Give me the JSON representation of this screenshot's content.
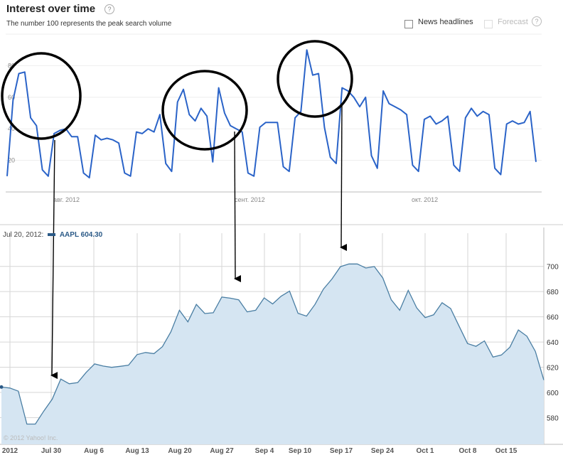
{
  "header": {
    "title": "Interest over time",
    "subtitle": "The number 100 represents the peak search volume",
    "help_label": "?",
    "news_label": "News headlines",
    "forecast_label": "Forecast"
  },
  "stock_tooltip": {
    "date": "Jul 20, 2012:",
    "symbol_value": "AAPL 604.30"
  },
  "copyright": "© 2012 Yahoo! Inc.",
  "colors": {
    "trend_line": "#2a63c8",
    "stock_line": "#4a7ea3",
    "stock_fill": "#d5e5f2",
    "annotation": "#000000"
  },
  "chart_data": [
    {
      "type": "line",
      "title": "Interest over time",
      "ylim": [
        0,
        100
      ],
      "y_ticks": [
        20,
        40,
        60,
        80
      ],
      "x_tick_labels": [
        "авг. 2012",
        "сент. 2012",
        "окт. 2012"
      ],
      "grid": true,
      "series": [
        {
          "values": [
            10,
            58,
            75,
            76,
            47,
            42,
            14,
            10,
            37,
            39,
            40,
            35,
            35,
            12,
            9,
            36,
            33,
            34,
            33,
            31,
            12,
            10,
            38,
            37,
            40,
            38,
            49,
            18,
            13,
            57,
            65,
            49,
            45,
            53,
            48,
            19,
            66,
            50,
            42,
            40,
            38,
            12,
            10,
            41,
            44,
            44,
            44,
            16,
            13,
            47,
            51,
            90,
            74,
            75,
            41,
            22,
            18,
            66,
            64,
            60,
            54,
            60,
            23,
            15,
            64,
            56,
            54,
            52,
            49,
            17,
            13,
            46,
            48,
            43,
            45,
            48,
            17,
            13,
            47,
            53,
            48,
            51,
            49,
            15,
            11,
            43,
            45,
            43,
            44,
            51,
            19
          ]
        }
      ]
    },
    {
      "type": "area",
      "ylim": [
        570,
        710
      ],
      "y_ticks": [
        580,
        600,
        620,
        640,
        660,
        680,
        700
      ],
      "x_tick_labels": [
        "2012",
        "Jul 30",
        "Aug 6",
        "Aug 13",
        "Aug 20",
        "Aug 27",
        "Sep 4",
        "Sep 10",
        "Sep 17",
        "Sep 24",
        "Oct 1",
        "Oct 8",
        "Oct 15"
      ],
      "grid": true,
      "series": [
        {
          "name": "AAPL",
          "values": [
            604.3,
            603.5,
            601,
            574.9,
            574.9,
            585.2,
            594.7,
            610.6,
            606.9,
            607.8,
            615.9,
            622.6,
            620.9,
            619.9,
            620.7,
            621.6,
            630,
            631.7,
            630.8,
            636.3,
            648.1,
            665.2,
            656,
            669.8,
            662.6,
            663.2,
            675.7,
            674.8,
            673.5,
            663.9,
            665.2,
            675,
            670.2,
            676.3,
            680.4,
            662.8,
            660.6,
            669.8,
            682,
            690,
            699.8,
            701.9,
            701.9,
            698.7,
            699.9,
            690.8,
            673.5,
            665.2,
            681,
            667.1,
            659.4,
            661.6,
            671.2,
            666.6,
            652.6,
            638.8,
            636.6,
            640.9,
            628.1,
            629.7,
            635.9,
            649.6,
            644.6,
            632.6,
            609.8
          ]
        }
      ]
    }
  ]
}
